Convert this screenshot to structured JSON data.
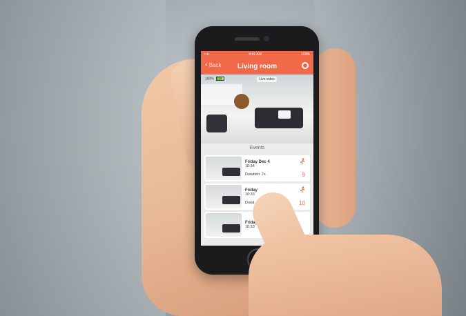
{
  "photo": {
    "subject": "phone-in-hands"
  },
  "app": {
    "status_bar": {
      "carrier": "•••• ",
      "time": "9:41 AM",
      "battery": "100%"
    },
    "nav": {
      "back_label": "Back",
      "title": "Living room"
    },
    "live_view": {
      "battery_level": "100%",
      "live_label": "Live video"
    },
    "events_header": "Events",
    "events": [
      {
        "date": "Friday Dec 4",
        "time": "10:34",
        "duration": "Duration: 7s",
        "count": "9"
      },
      {
        "date": "Friday",
        "time": "10:33",
        "duration": "Durat",
        "count": "10"
      },
      {
        "date": "Friday",
        "time": "10:33",
        "duration": "",
        "count": ""
      }
    ],
    "accent_color": "#f06a4a"
  }
}
